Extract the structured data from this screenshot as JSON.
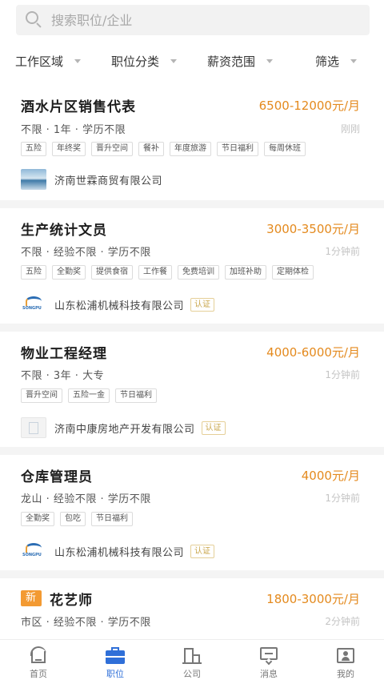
{
  "search": {
    "placeholder": "搜索职位/企业"
  },
  "filters": [
    "工作区域",
    "职位分类",
    "薪资范围",
    "筛选"
  ],
  "jobs": [
    {
      "title": "酒水片区销售代表",
      "is_new": false,
      "salary": "6500-12000元/月",
      "meta": "不限 · 1年 · 学历不限",
      "time": "刚刚",
      "tags": [
        "五险",
        "年终奖",
        "晋升空间",
        "餐补",
        "年度旅游",
        "节日福利",
        "每周休班"
      ],
      "company": "济南世霖商贸有限公司",
      "verified": "",
      "logo": "sea-logo"
    },
    {
      "title": "生产统计文员",
      "is_new": false,
      "salary": "3000-3500元/月",
      "meta": "不限 · 经验不限 · 学历不限",
      "time": "1分钟前",
      "tags": [
        "五险",
        "全勤奖",
        "提供食宿",
        "工作餐",
        "免费培训",
        "加班补助",
        "定期体检"
      ],
      "company": "山东松浦机械科技有限公司",
      "verified": "认证",
      "logo": "songpu-logo"
    },
    {
      "title": "物业工程经理",
      "is_new": false,
      "salary": "4000-6000元/月",
      "meta": "不限 · 3年 · 大专",
      "time": "1分钟前",
      "tags": [
        "晋升空间",
        "五险一金",
        "节日福利"
      ],
      "company": "济南中康房地产开发有限公司",
      "verified": "认证",
      "logo": "building-logo"
    },
    {
      "title": "仓库管理员",
      "is_new": false,
      "salary": "4000元/月",
      "meta": "龙山 · 经验不限 · 学历不限",
      "time": "1分钟前",
      "tags": [
        "全勤奖",
        "包吃",
        "节日福利"
      ],
      "company": "山东松浦机械科技有限公司",
      "verified": "认证",
      "logo": "songpu-logo"
    },
    {
      "title": "花艺师",
      "is_new": true,
      "new_label": "新",
      "salary": "1800-3000元/月",
      "meta": "市区 · 经验不限 · 学历不限",
      "time": "2分钟前",
      "tags": [],
      "company": "",
      "verified": "",
      "logo": ""
    }
  ],
  "tabbar": [
    {
      "label": "首页",
      "icon": "home-icon",
      "active": false
    },
    {
      "label": "职位",
      "icon": "briefcase-icon",
      "active": true
    },
    {
      "label": "公司",
      "icon": "building-icon",
      "active": false
    },
    {
      "label": "消息",
      "icon": "message-icon",
      "active": false
    },
    {
      "label": "我的",
      "icon": "profile-icon",
      "active": false
    }
  ],
  "colors": {
    "accent": "#2f6fd8",
    "salary": "#e48a1e",
    "new_badge": "#f39a32",
    "verified": "#c9a54a"
  }
}
